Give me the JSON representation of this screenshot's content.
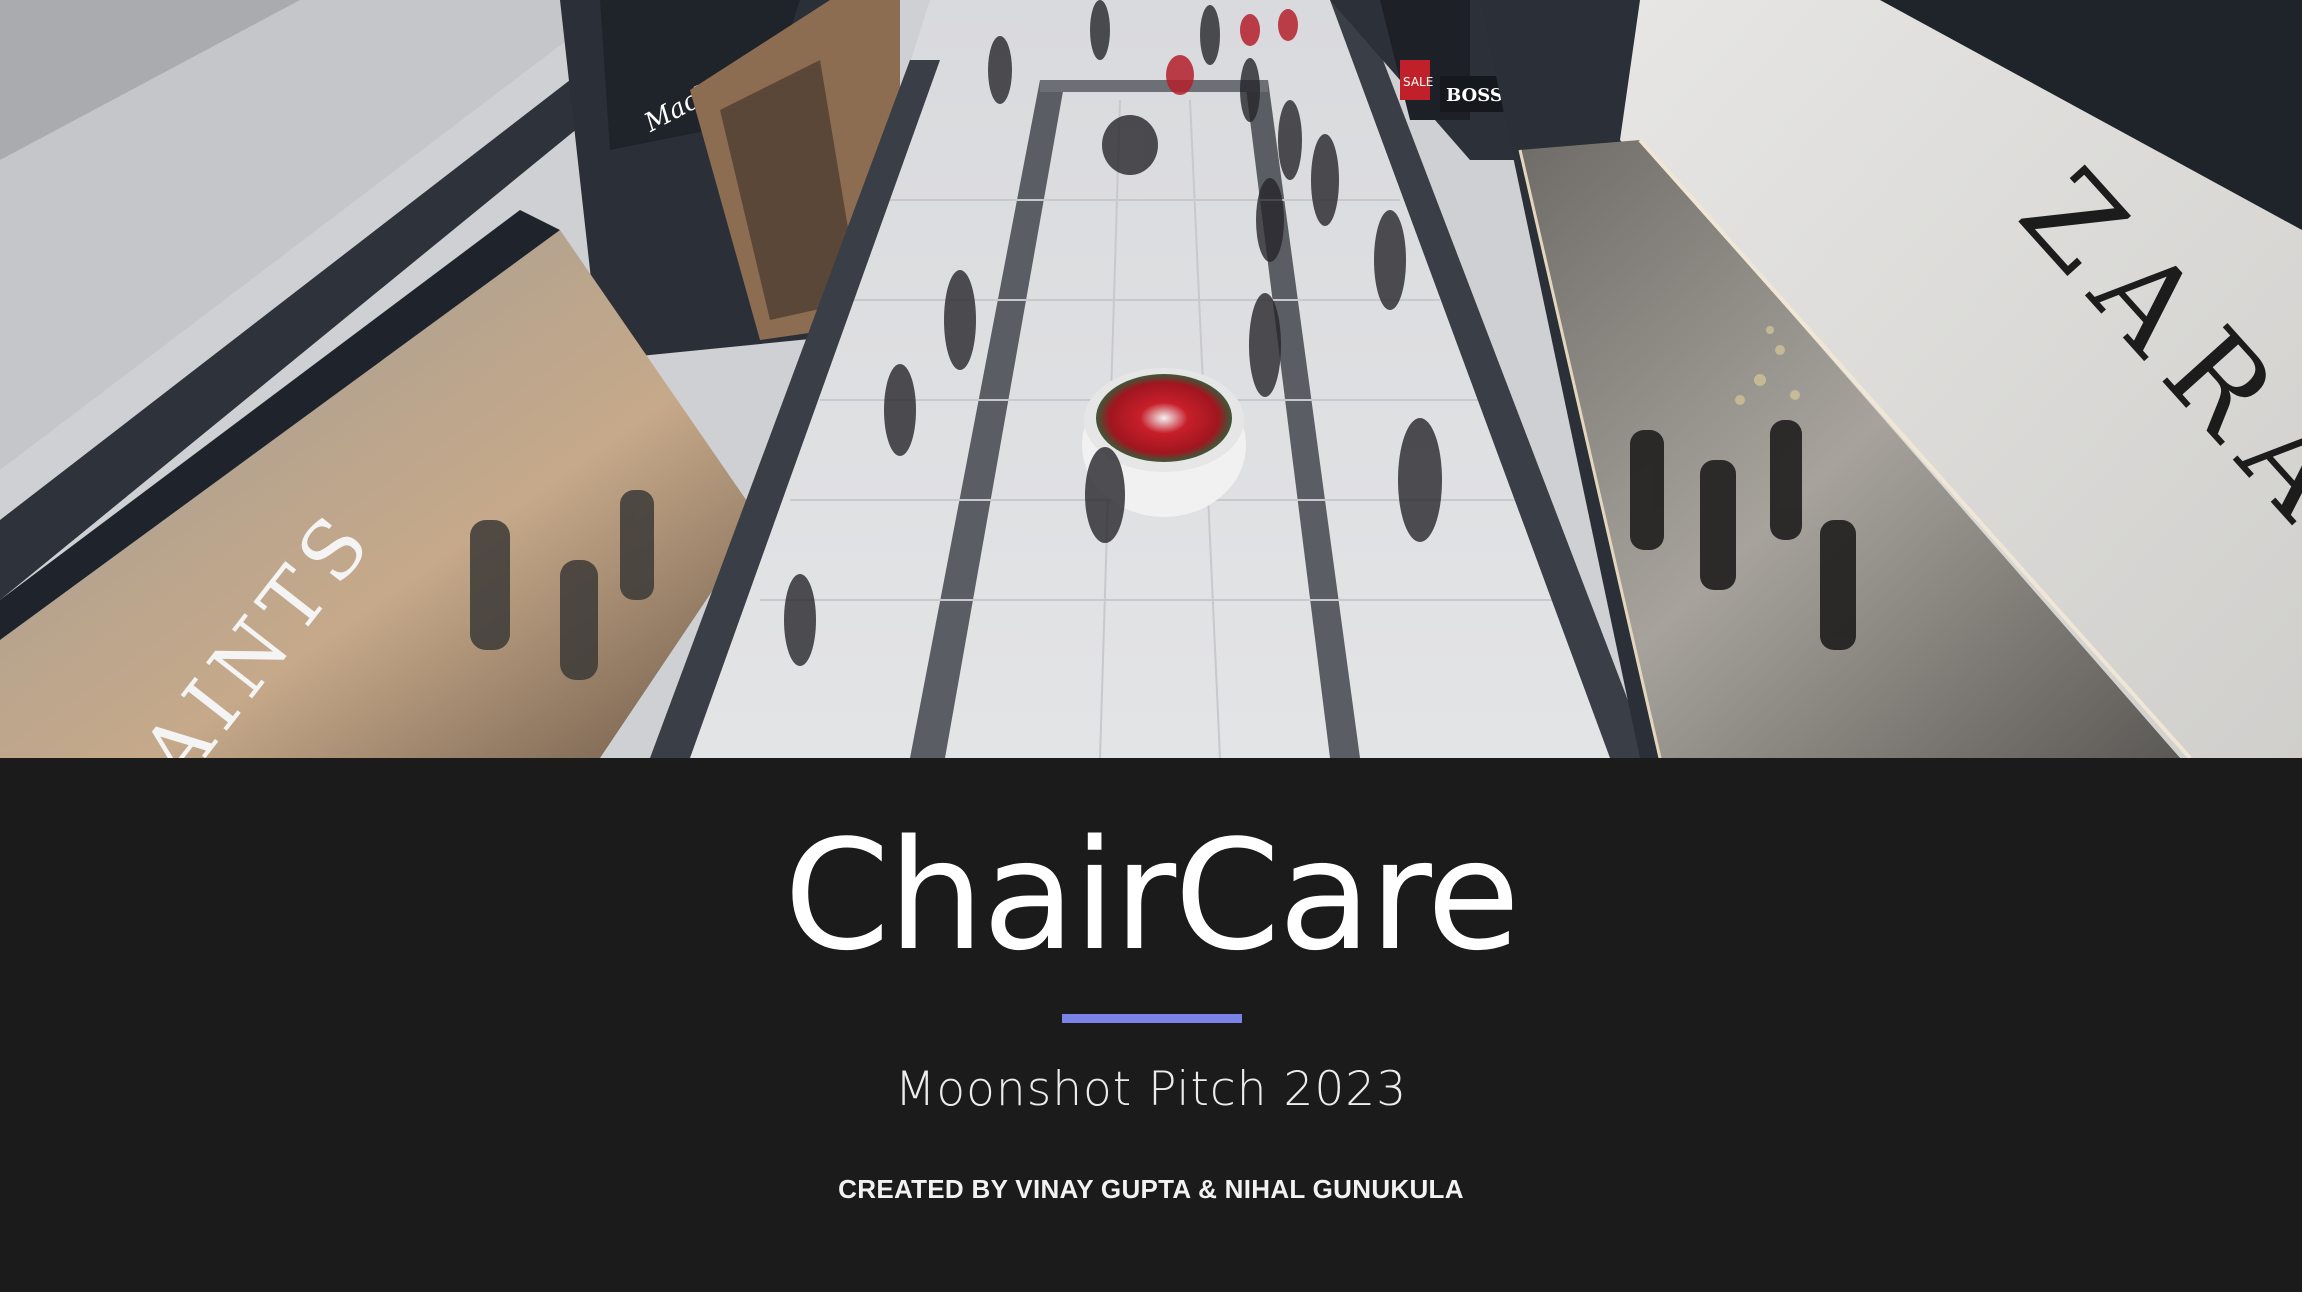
{
  "slide": {
    "title": "ChairCare",
    "subtitle": "Moonshot Pitch 2023",
    "credits": "CREATED BY VINAY GUPTA & NIHAL GUNUKULA"
  },
  "hero_photo": {
    "storefront_signs": {
      "left_store": "AINTS",
      "left_upper_store": "Mackage",
      "right_store": "ZARA",
      "far_right_store": "BOSS",
      "sale_sign": "SALE"
    }
  },
  "colors": {
    "background": "#1b1b1b",
    "title_text": "#ffffff",
    "accent": "#7b83e8"
  }
}
